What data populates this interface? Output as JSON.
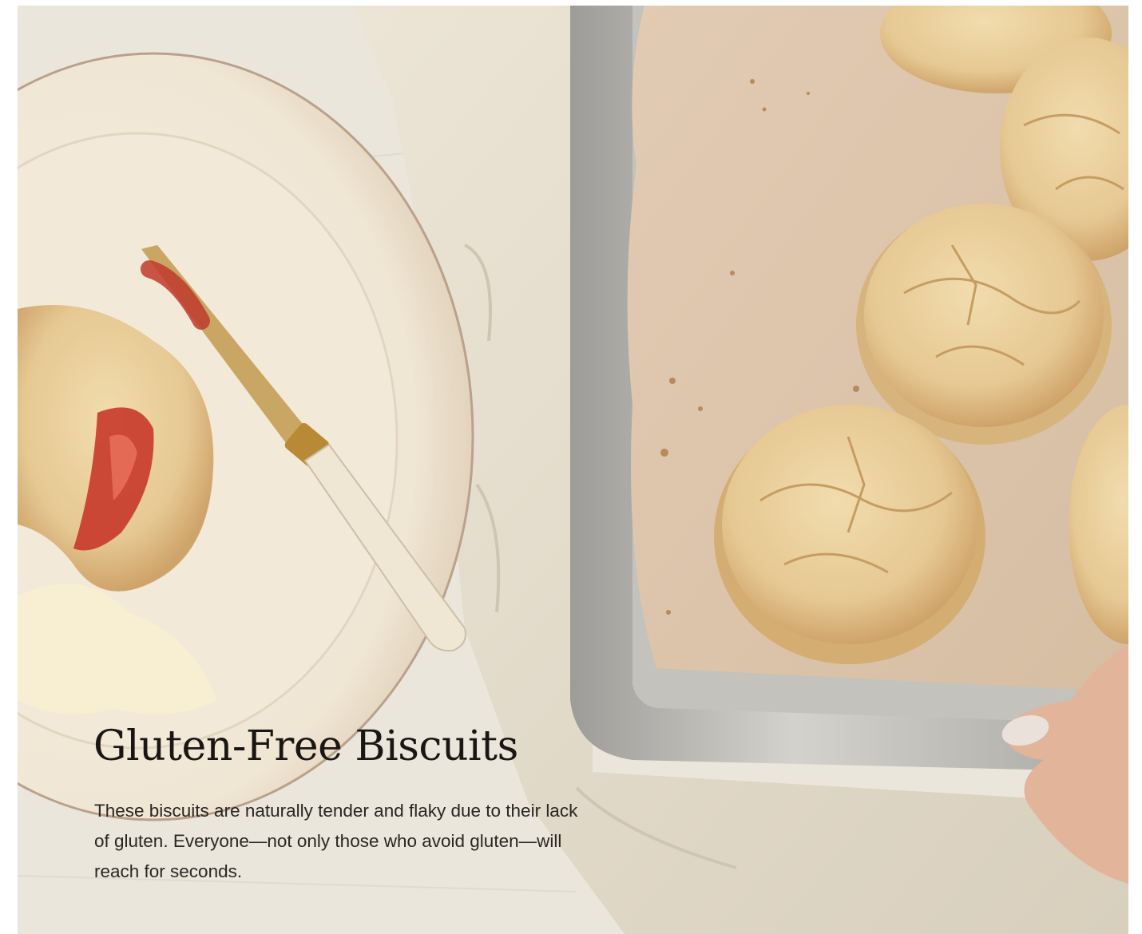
{
  "recipe": {
    "title": "Gluten-Free Biscuits",
    "description": "These biscuits are naturally tender and flaky due to their lack of gluten. Everyone—not only those who avoid gluten—will reach for seconds."
  },
  "photo": {
    "subject": "biscuits on parchment-lined baking sheet beside plate with jam-spread biscuit and knife",
    "colors": {
      "table": "#ebe6dc",
      "linen": "#e4dccb",
      "plate": "#f3ebdc",
      "pan": "#b9b7b2",
      "parchment": "#dcc3a8",
      "biscuit": "#e9cf9e",
      "jam": "#c23c2c"
    }
  }
}
